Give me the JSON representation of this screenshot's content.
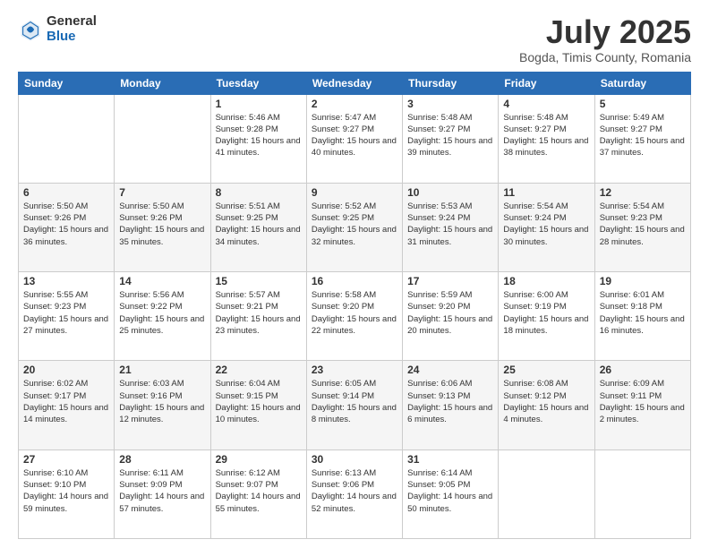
{
  "logo": {
    "general": "General",
    "blue": "Blue"
  },
  "title": "July 2025",
  "subtitle": "Bogda, Timis County, Romania",
  "headers": [
    "Sunday",
    "Monday",
    "Tuesday",
    "Wednesday",
    "Thursday",
    "Friday",
    "Saturday"
  ],
  "weeks": [
    [
      {
        "day": "",
        "info": ""
      },
      {
        "day": "",
        "info": ""
      },
      {
        "day": "1",
        "info": "Sunrise: 5:46 AM\nSunset: 9:28 PM\nDaylight: 15 hours\nand 41 minutes."
      },
      {
        "day": "2",
        "info": "Sunrise: 5:47 AM\nSunset: 9:27 PM\nDaylight: 15 hours\nand 40 minutes."
      },
      {
        "day": "3",
        "info": "Sunrise: 5:48 AM\nSunset: 9:27 PM\nDaylight: 15 hours\nand 39 minutes."
      },
      {
        "day": "4",
        "info": "Sunrise: 5:48 AM\nSunset: 9:27 PM\nDaylight: 15 hours\nand 38 minutes."
      },
      {
        "day": "5",
        "info": "Sunrise: 5:49 AM\nSunset: 9:27 PM\nDaylight: 15 hours\nand 37 minutes."
      }
    ],
    [
      {
        "day": "6",
        "info": "Sunrise: 5:50 AM\nSunset: 9:26 PM\nDaylight: 15 hours\nand 36 minutes."
      },
      {
        "day": "7",
        "info": "Sunrise: 5:50 AM\nSunset: 9:26 PM\nDaylight: 15 hours\nand 35 minutes."
      },
      {
        "day": "8",
        "info": "Sunrise: 5:51 AM\nSunset: 9:25 PM\nDaylight: 15 hours\nand 34 minutes."
      },
      {
        "day": "9",
        "info": "Sunrise: 5:52 AM\nSunset: 9:25 PM\nDaylight: 15 hours\nand 32 minutes."
      },
      {
        "day": "10",
        "info": "Sunrise: 5:53 AM\nSunset: 9:24 PM\nDaylight: 15 hours\nand 31 minutes."
      },
      {
        "day": "11",
        "info": "Sunrise: 5:54 AM\nSunset: 9:24 PM\nDaylight: 15 hours\nand 30 minutes."
      },
      {
        "day": "12",
        "info": "Sunrise: 5:54 AM\nSunset: 9:23 PM\nDaylight: 15 hours\nand 28 minutes."
      }
    ],
    [
      {
        "day": "13",
        "info": "Sunrise: 5:55 AM\nSunset: 9:23 PM\nDaylight: 15 hours\nand 27 minutes."
      },
      {
        "day": "14",
        "info": "Sunrise: 5:56 AM\nSunset: 9:22 PM\nDaylight: 15 hours\nand 25 minutes."
      },
      {
        "day": "15",
        "info": "Sunrise: 5:57 AM\nSunset: 9:21 PM\nDaylight: 15 hours\nand 23 minutes."
      },
      {
        "day": "16",
        "info": "Sunrise: 5:58 AM\nSunset: 9:20 PM\nDaylight: 15 hours\nand 22 minutes."
      },
      {
        "day": "17",
        "info": "Sunrise: 5:59 AM\nSunset: 9:20 PM\nDaylight: 15 hours\nand 20 minutes."
      },
      {
        "day": "18",
        "info": "Sunrise: 6:00 AM\nSunset: 9:19 PM\nDaylight: 15 hours\nand 18 minutes."
      },
      {
        "day": "19",
        "info": "Sunrise: 6:01 AM\nSunset: 9:18 PM\nDaylight: 15 hours\nand 16 minutes."
      }
    ],
    [
      {
        "day": "20",
        "info": "Sunrise: 6:02 AM\nSunset: 9:17 PM\nDaylight: 15 hours\nand 14 minutes."
      },
      {
        "day": "21",
        "info": "Sunrise: 6:03 AM\nSunset: 9:16 PM\nDaylight: 15 hours\nand 12 minutes."
      },
      {
        "day": "22",
        "info": "Sunrise: 6:04 AM\nSunset: 9:15 PM\nDaylight: 15 hours\nand 10 minutes."
      },
      {
        "day": "23",
        "info": "Sunrise: 6:05 AM\nSunset: 9:14 PM\nDaylight: 15 hours\nand 8 minutes."
      },
      {
        "day": "24",
        "info": "Sunrise: 6:06 AM\nSunset: 9:13 PM\nDaylight: 15 hours\nand 6 minutes."
      },
      {
        "day": "25",
        "info": "Sunrise: 6:08 AM\nSunset: 9:12 PM\nDaylight: 15 hours\nand 4 minutes."
      },
      {
        "day": "26",
        "info": "Sunrise: 6:09 AM\nSunset: 9:11 PM\nDaylight: 15 hours\nand 2 minutes."
      }
    ],
    [
      {
        "day": "27",
        "info": "Sunrise: 6:10 AM\nSunset: 9:10 PM\nDaylight: 14 hours\nand 59 minutes."
      },
      {
        "day": "28",
        "info": "Sunrise: 6:11 AM\nSunset: 9:09 PM\nDaylight: 14 hours\nand 57 minutes."
      },
      {
        "day": "29",
        "info": "Sunrise: 6:12 AM\nSunset: 9:07 PM\nDaylight: 14 hours\nand 55 minutes."
      },
      {
        "day": "30",
        "info": "Sunrise: 6:13 AM\nSunset: 9:06 PM\nDaylight: 14 hours\nand 52 minutes."
      },
      {
        "day": "31",
        "info": "Sunrise: 6:14 AM\nSunset: 9:05 PM\nDaylight: 14 hours\nand 50 minutes."
      },
      {
        "day": "",
        "info": ""
      },
      {
        "day": "",
        "info": ""
      }
    ]
  ]
}
